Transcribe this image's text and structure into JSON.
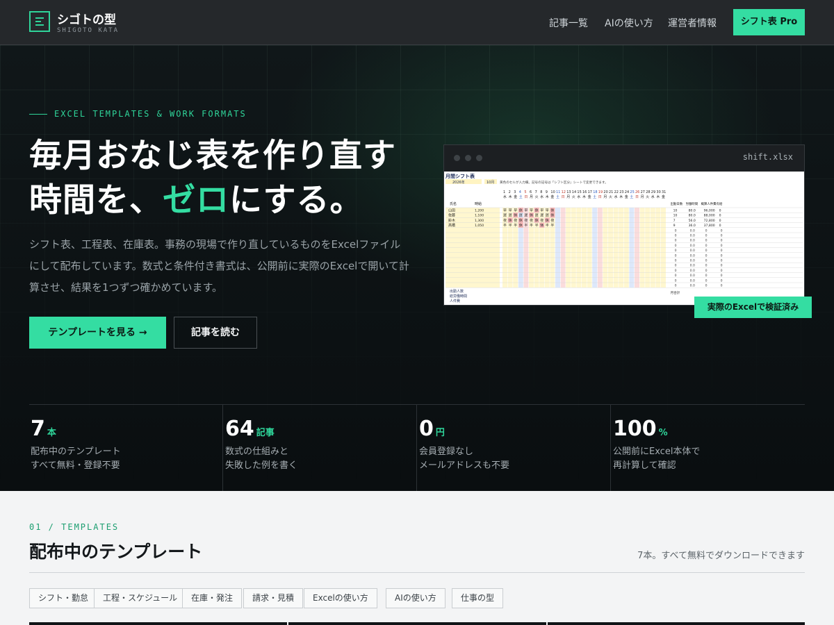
{
  "header": {
    "brand_name": "シゴトの型",
    "brand_sub": "SHIGOTO KATA",
    "nav": [
      "記事一覧",
      "AIの使い方",
      "運営者情報"
    ],
    "cta": "シフト表 Pro"
  },
  "hero": {
    "eyebrow": "EXCEL TEMPLATES & WORK FORMATS",
    "headline_line1": "毎月おなじ表を作り直す",
    "headline_line2_pre": "時間を、",
    "headline_line2_accent": "ゼロ",
    "headline_line2_post": "にする。",
    "lead": "シフト表、工程表、在庫表。事務の現場で作り直しているものをExcelファイルにして配布しています。数式と条件付き書式は、公開前に実際のExcelで開いて計算させ、結果を1つずつ確かめています。",
    "primary_button": "テンプレートを見る →",
    "secondary_button": "記事を読む",
    "preview_filename": "shift.xlsx",
    "verify_badge": "実際のExcelで検証済み"
  },
  "sheet": {
    "title": "月間シフト表",
    "year": "2026年",
    "month": "10月",
    "note": "黄色のセルが入力欄。記号の記号は「シフト区分」シートで変更できます。",
    "col_name": "氏名",
    "col_rate": "時給",
    "days": [
      "1",
      "2",
      "3",
      "4",
      "5",
      "6",
      "7",
      "8",
      "9",
      "10",
      "11",
      "12",
      "13",
      "14",
      "15",
      "16",
      "17",
      "18",
      "19",
      "20",
      "21",
      "22",
      "23",
      "24",
      "25",
      "26",
      "27",
      "28",
      "29",
      "30",
      "31"
    ],
    "weekdays": [
      "水",
      "木",
      "金",
      "土",
      "日",
      "月",
      "火",
      "水",
      "木",
      "金",
      "土",
      "日",
      "月",
      "火",
      "水",
      "木",
      "金",
      "土",
      "日",
      "月",
      "火",
      "水",
      "木",
      "金",
      "土",
      "日",
      "月",
      "火",
      "水",
      "木",
      "金"
    ],
    "summary_headers": [
      "出勤日数",
      "労働時間",
      "概算人件費",
      "有給"
    ],
    "staff": [
      {
        "name": "山田",
        "rate": "1,200",
        "shifts": [
          "早",
          "早",
          "早",
          "休",
          "早",
          "早",
          "休",
          "早",
          "早",
          "休"
        ],
        "summary": [
          "10",
          "80.0",
          "96,000",
          "0"
        ]
      },
      {
        "name": "佐藤",
        "rate": "1,100",
        "shifts": [
          "遅",
          "遅",
          "休",
          "遅",
          "遅",
          "休",
          "遅",
          "遅",
          "遅",
          "休"
        ],
        "summary": [
          "10",
          "80.0",
          "88,000",
          "0"
        ]
      },
      {
        "name": "鈴木",
        "rate": "1,300",
        "shifts": [
          "夜",
          "休",
          "夜",
          "休",
          "夜",
          "夜",
          "休",
          "夜",
          "休",
          "夜"
        ],
        "summary": [
          "7",
          "56.0",
          "72,800",
          "0"
        ]
      },
      {
        "name": "高橋",
        "rate": "1,050",
        "shifts": [
          "半",
          "半",
          "半",
          "休",
          "半",
          "半",
          "半",
          "休",
          "半",
          "半"
        ],
        "summary": [
          "9",
          "36.0",
          "37,800",
          "0"
        ]
      }
    ],
    "empty_summary": [
      "0",
      "0.0",
      "0",
      "0"
    ],
    "footer_rows": [
      "出勤人数",
      "総労働時間",
      "人件費"
    ],
    "footer_total_label": "月合計"
  },
  "stats": [
    {
      "value": "7",
      "unit": "本",
      "line1": "配布中のテンプレート",
      "line2": "すべて無料・登録不要"
    },
    {
      "value": "64",
      "unit": "記事",
      "line1": "数式の仕組みと",
      "line2": "失敗した例を書く"
    },
    {
      "value": "0",
      "unit": "円",
      "line1": "会員登録なし",
      "line2": "メールアドレスも不要"
    },
    {
      "value": "100",
      "unit": "%",
      "line1": "公開前にExcel本体で",
      "line2": "再計算して確認"
    }
  ],
  "templates": {
    "eyebrow": "01 / TEMPLATES",
    "title": "配布中のテンプレート",
    "note": "7本。すべて無料でダウンロードできます",
    "tags": [
      "シフト・勤怠",
      "工程・スケジュール",
      "在庫・発注",
      "請求・見積",
      "Excelの使い方",
      "AIの使い方",
      "仕事の型"
    ]
  },
  "colors": {
    "accent": "#34dda2",
    "header_bg": "#25282b",
    "hero_bg": "#0d1114",
    "section_bg": "#f3f4f5"
  }
}
